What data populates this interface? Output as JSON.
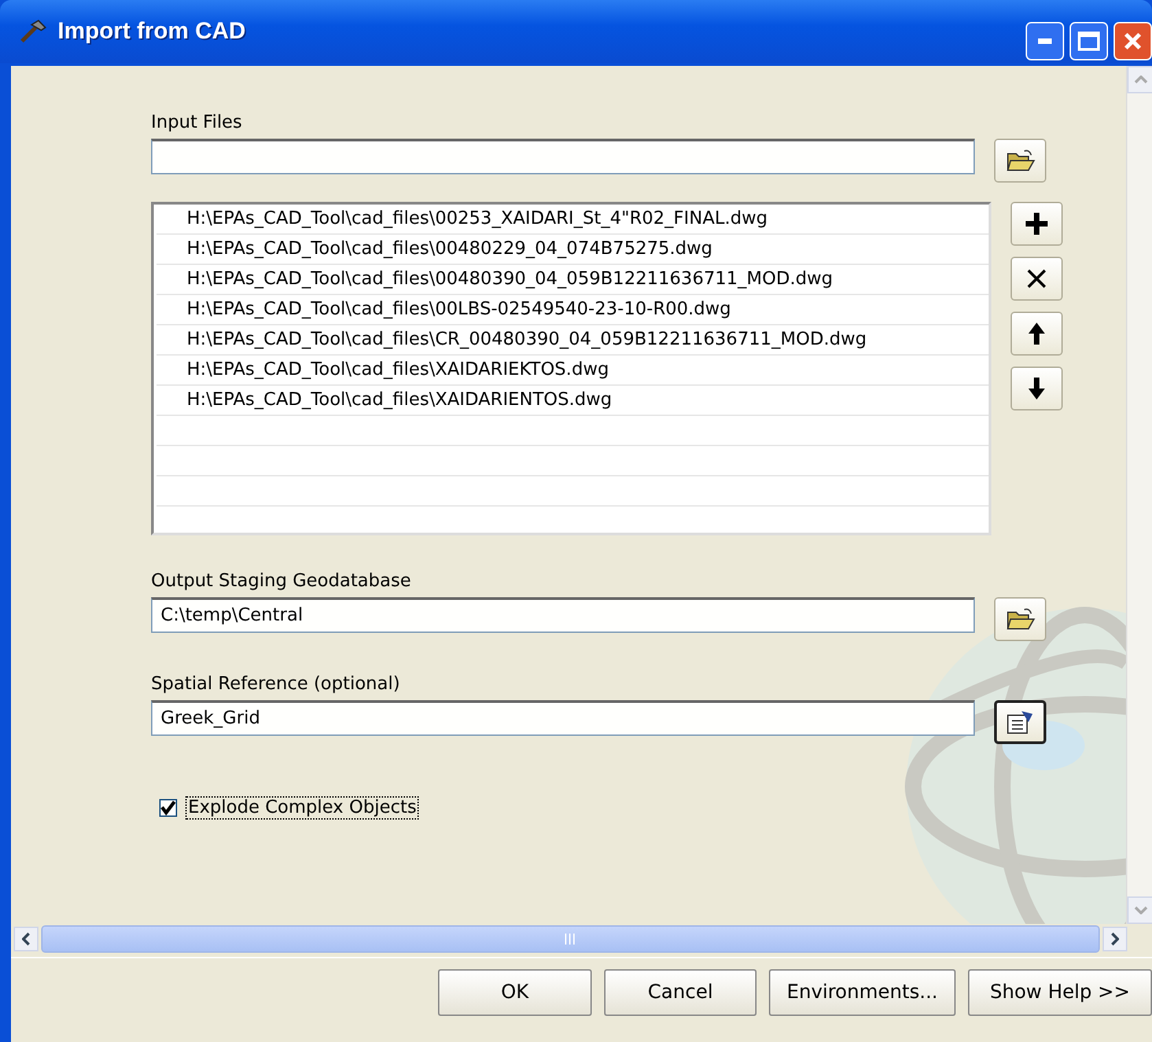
{
  "window": {
    "title": "Import from CAD"
  },
  "input_files": {
    "label": "Input Files",
    "items": [
      "H:\\EPAs_CAD_Tool\\cad_files\\00253_XAIDARI_St_4\"R02_FINAL.dwg",
      "H:\\EPAs_CAD_Tool\\cad_files\\00480229_04_074B75275.dwg",
      "H:\\EPAs_CAD_Tool\\cad_files\\00480390_04_059B12211636711_MOD.dwg",
      "H:\\EPAs_CAD_Tool\\cad_files\\00LBS-02549540-23-10-R00.dwg",
      "H:\\EPAs_CAD_Tool\\cad_files\\CR_00480390_04_059B12211636711_MOD.dwg",
      "H:\\EPAs_CAD_Tool\\cad_files\\XAIDARIEKTOS.dwg",
      "H:\\EPAs_CAD_Tool\\cad_files\\XAIDARIENTOS.dwg"
    ]
  },
  "output_geodatabase": {
    "label": "Output Staging Geodatabase",
    "value": "C:\\temp\\Central"
  },
  "spatial_reference": {
    "label": "Spatial Reference (optional)",
    "value": "Greek_Grid"
  },
  "explode_option": {
    "label": "Explode Complex Objects",
    "checked": true
  },
  "buttons": [
    "OK",
    "Cancel",
    "Environments...",
    "Show Help >>"
  ]
}
